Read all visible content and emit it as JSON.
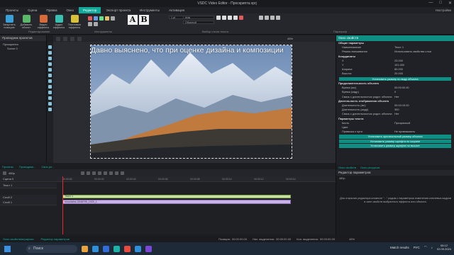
{
  "window": {
    "title": "VSDC Video Editor - Проскрипта.vprj"
  },
  "menu": {
    "items": [
      "Проекты",
      "Сцена",
      "Правка",
      "Окно",
      "Редактор",
      "Экспорт проекта",
      "Инструменты",
      "Активация"
    ],
    "active_index": 4,
    "right": "Настройки"
  },
  "ribbon": {
    "buttons": [
      "Запустить позицию",
      "Добавить объект",
      "Видео эффекты",
      "Аудио эффекты",
      "Текстовые эффекты"
    ],
    "group_editing": "Редактирование",
    "group_tools": "Инструменты",
    "font_name": "Arial",
    "font_size": "1 pt",
    "font_style": "Обычный",
    "alignment_label": "Выбор стиля текста",
    "paragraph_label": "Параграф",
    "big_letters": [
      "A",
      "B"
    ]
  },
  "left_panel": {
    "title": "Проводник проектов",
    "tree": [
      "Проскрипта",
      "Scene 0"
    ]
  },
  "canvas": {
    "overlay_text": "Давно выяснено, что при оценке дизайна и композиции",
    "zoom": "45%"
  },
  "properties": {
    "title": "Окно свойств",
    "rows": [
      {
        "type": "sec",
        "k": "Общие параметры",
        "v": ""
      },
      {
        "type": "row",
        "k": "Наименование",
        "v": "Текст 1"
      },
      {
        "type": "row",
        "k": "Режим смешивания",
        "v": "Использовать свойства слоя"
      },
      {
        "type": "sec",
        "k": "Координаты",
        "v": ""
      },
      {
        "type": "row",
        "k": "X",
        "v": "23.000"
      },
      {
        "type": "row",
        "k": "Y",
        "v": "101.000"
      },
      {
        "type": "row",
        "k": "Ширина",
        "v": "80.000"
      },
      {
        "type": "row",
        "k": "Высота",
        "v": "20.000"
      },
      {
        "type": "btn",
        "k": "Установить размер по виду объекта",
        "v": ""
      },
      {
        "type": "sec",
        "k": "Продолжительность объекта",
        "v": ""
      },
      {
        "type": "row",
        "k": "Время (мс)",
        "v": "00:00:00.00"
      },
      {
        "type": "row",
        "k": "Время (кадр)",
        "v": "0"
      },
      {
        "type": "row",
        "k": "Связь с длительностью родит. объекта",
        "v": "Нет"
      },
      {
        "type": "sec",
        "k": "Длительность отображения объекта",
        "v": ""
      },
      {
        "type": "row",
        "k": "Длительность (мс)",
        "v": "00:00:15.00"
      },
      {
        "type": "row",
        "k": "Длительность (кадр)",
        "v": "300"
      },
      {
        "type": "row",
        "k": "Связь с длительностью родит. объекта",
        "v": "Нет"
      },
      {
        "type": "sec",
        "k": "Параметры текста",
        "v": ""
      },
      {
        "type": "row",
        "k": "Кисть",
        "v": "Прозрачный"
      },
      {
        "type": "row",
        "k": "Цвет",
        "v": ""
      },
      {
        "type": "row",
        "k": "Привязка к пути",
        "v": "Не привязывать"
      },
      {
        "type": "btn",
        "k": "Установить оригинальный размер объекта",
        "v": ""
      },
      {
        "type": "btn",
        "k": "Установить размер шрифта по ширине",
        "v": ""
      },
      {
        "type": "btn",
        "k": "Установить размер шрифта по высоте",
        "v": ""
      }
    ],
    "tabs": [
      "Окно свойств",
      "Окно ресурсов"
    ]
  },
  "bottom_tabs": [
    "Проекты",
    "Проводник...",
    "Окно ре..."
  ],
  "transport": {
    "resolution": "480p"
  },
  "timeline": {
    "ruler": [
      "00:00:00",
      "00:00:02",
      "00:00:04",
      "00:00:06",
      "00:00:08",
      "00:00:10",
      "00:00:12",
      "00:00:14"
    ],
    "tracks": [
      "Сцена 0",
      "Текст 1",
      "Слой 2",
      "Слой 1"
    ],
    "clip_text": "Текст 1",
    "clip_image": "mountains-3048799_1920_1"
  },
  "param_editor": {
    "title": "Редактор параметров",
    "resolution": "480p",
    "hint": "Для открытия редактора кликните \"...\" рядом с параметром изменения ключевых кадров в окне свойств выбранного эффекта или объекта."
  },
  "status": {
    "links": [
      "Окно свойств/иерархия",
      "Редактор параметров"
    ],
    "position_label": "Позиция:",
    "position": "00:00:00.00",
    "start_label": "Нач. выделения:",
    "start": "00:00:00.00",
    "end_label": "Кон. выделения:",
    "end": "00:00:00.00",
    "zoom": "45%"
  },
  "taskbar": {
    "search": "Поиск",
    "notification": "Match results",
    "time": "06:12",
    "date": "02.09.2024",
    "lang": "РУС"
  },
  "colors": {
    "accent": "#10a99a",
    "text_clip": "#c9e1a6",
    "image_clip": "#c7b3e4"
  }
}
